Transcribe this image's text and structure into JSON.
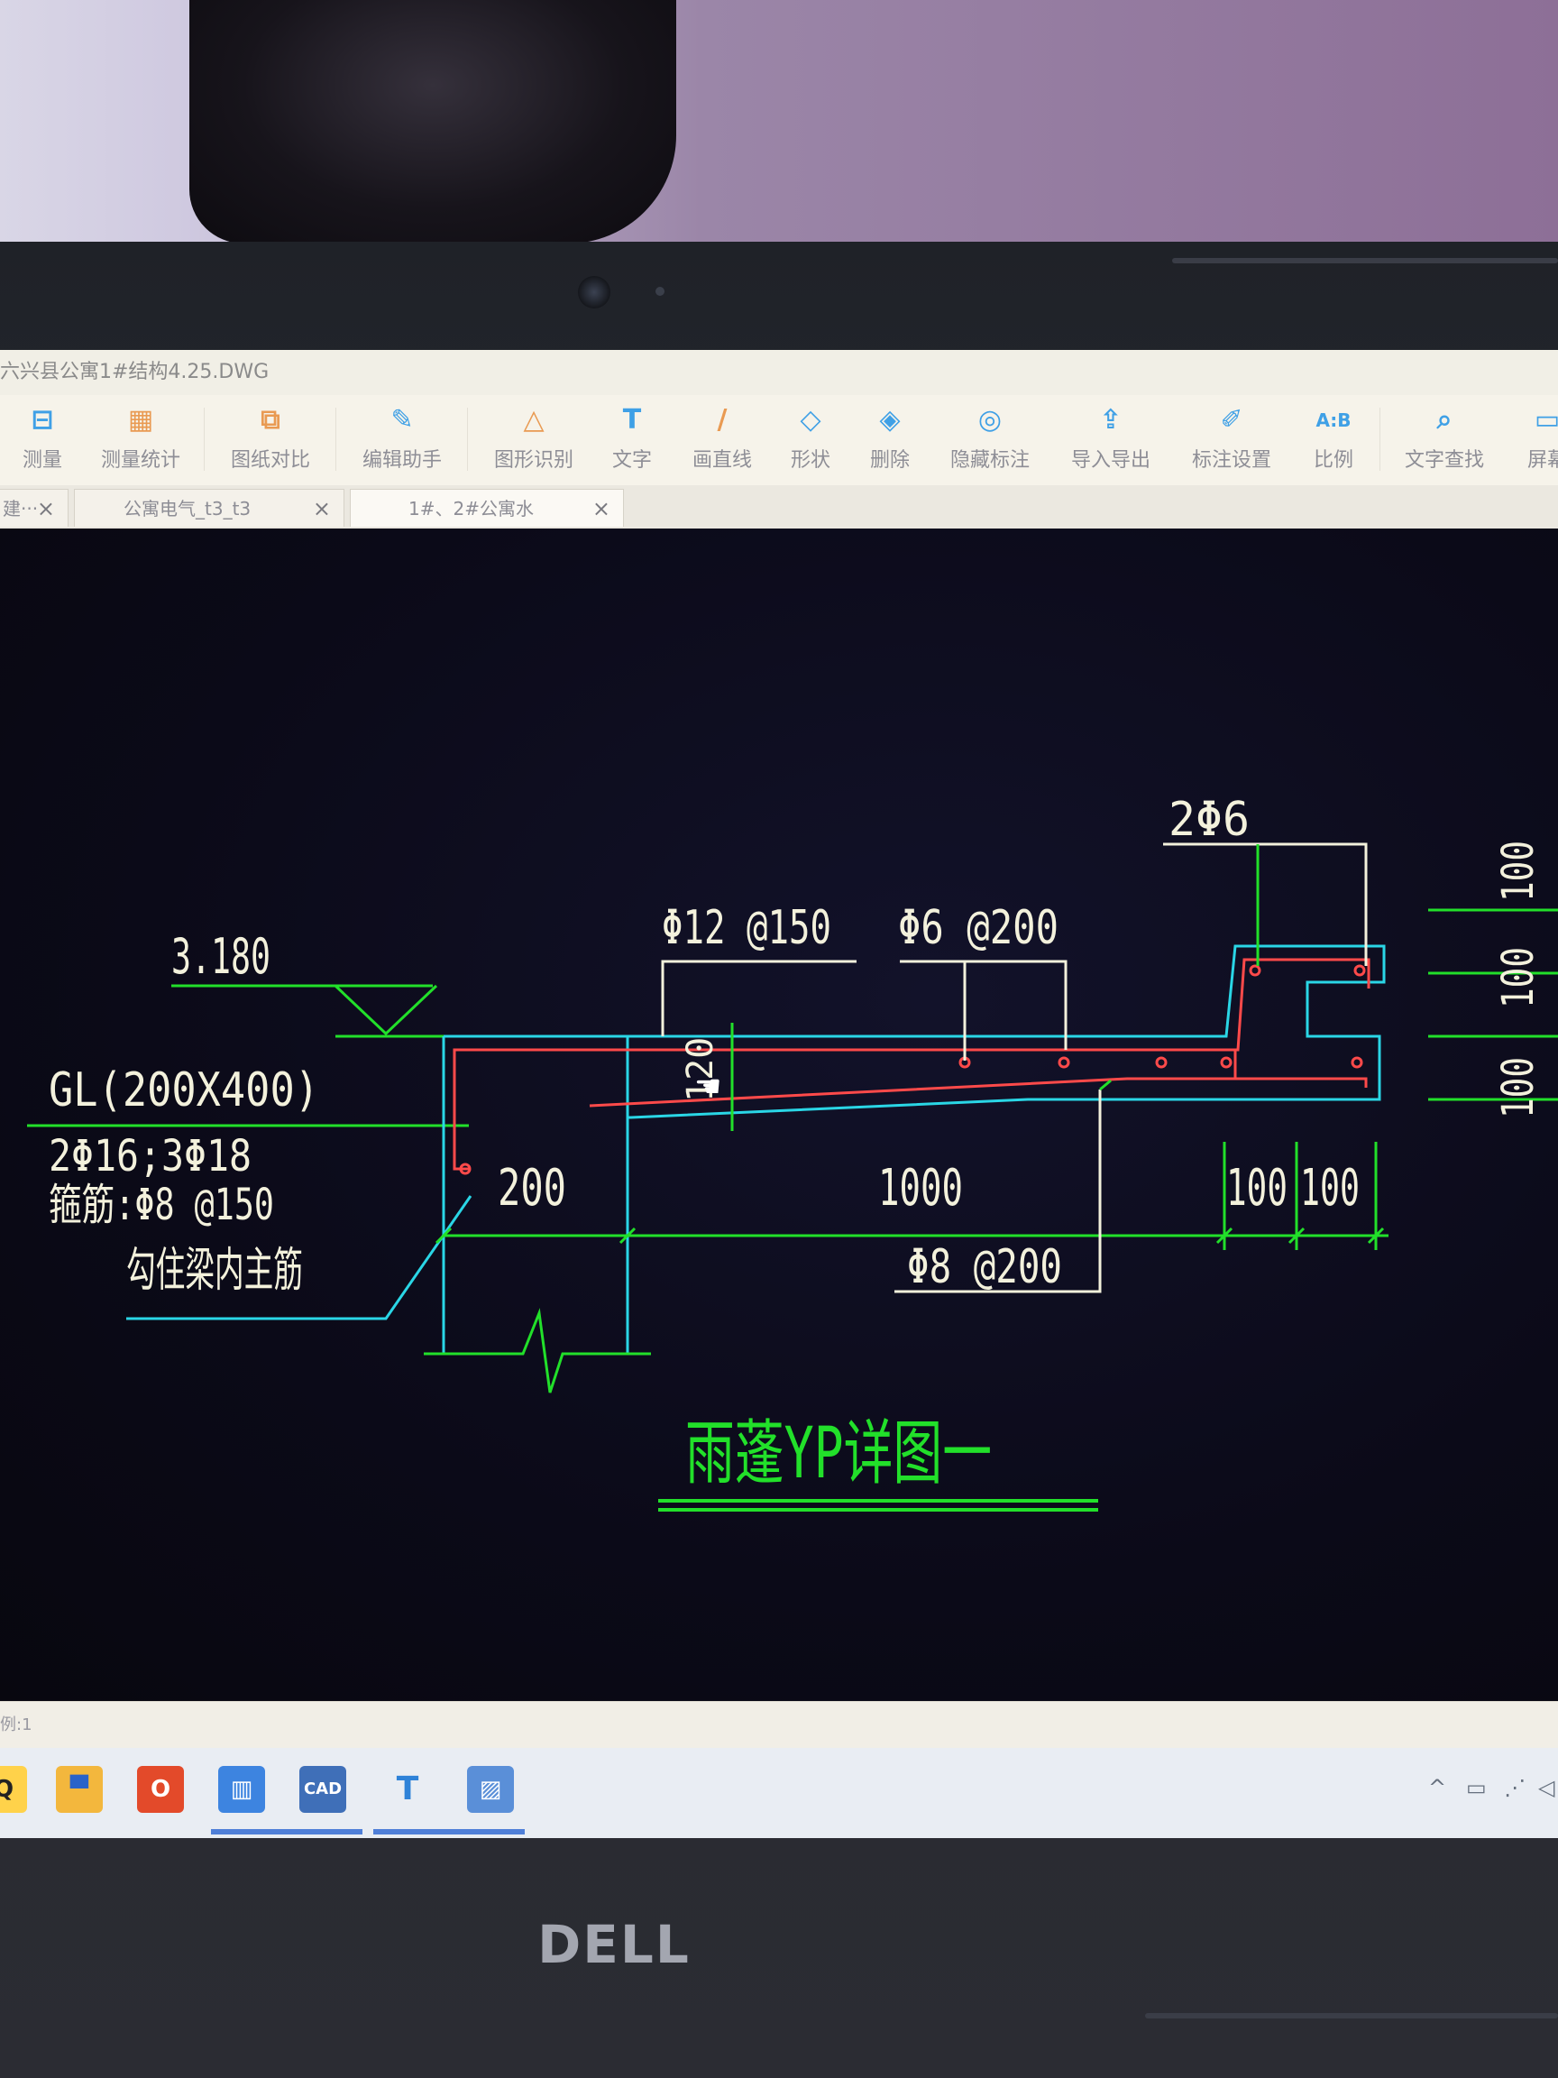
{
  "window": {
    "title": "六兴县公寓1#结构4.25.DWG"
  },
  "toolbar": {
    "items": [
      {
        "label": "测量",
        "icon": "measure-icon"
      },
      {
        "label": "测量统计",
        "icon": "measure-stats-icon"
      },
      {
        "label": "图纸对比",
        "icon": "compare-icon"
      },
      {
        "label": "编辑助手",
        "icon": "edit-assistant-icon"
      },
      {
        "label": "图形识别",
        "icon": "shape-recognition-icon"
      },
      {
        "label": "文字",
        "icon": "text-icon"
      },
      {
        "label": "画直线",
        "icon": "line-icon"
      },
      {
        "label": "形状",
        "icon": "shape-icon"
      },
      {
        "label": "删除",
        "icon": "eraser-icon"
      },
      {
        "label": "隐藏标注",
        "icon": "eye-hide-icon"
      },
      {
        "label": "导入导出",
        "icon": "import-export-icon"
      },
      {
        "label": "标注设置",
        "icon": "annotation-settings-icon"
      },
      {
        "label": "比例",
        "icon": "scale-icon"
      },
      {
        "label": "文字查找",
        "icon": "text-search-icon"
      },
      {
        "label": "屏幕",
        "icon": "screen-icon"
      }
    ]
  },
  "tabs": [
    {
      "label": "建···",
      "close": "×"
    },
    {
      "label": "公寓电气_t3_t3",
      "close": "×"
    },
    {
      "label": "1#、2#公寓水",
      "close": "×"
    }
  ],
  "drawing": {
    "elevation": "3.180",
    "beam_label": "GL(200X400)",
    "beam_bars": "2Φ16;3Φ18",
    "stirrup": "箍筋:Φ8 @150",
    "hook_note": "勾住梁内主筋",
    "top_bar_1": "Φ12 @150",
    "top_bar_2": "Φ6 @200",
    "edge_bars": "2Φ6",
    "slab_thickness": "120",
    "dim_200": "200",
    "dim_1000": "1000",
    "dim_100a": "100",
    "dim_100b": "100",
    "bottom_bar": "Φ8 @200",
    "right_dim_1": "100",
    "right_dim_2": "100",
    "right_dim_3": "100",
    "title": "雨蓬YP详图一",
    "colors": {
      "green": "#22e02a",
      "cyan": "#2ad6e6",
      "red": "#ff4a4a",
      "white": "#f3f1dc"
    }
  },
  "statusbar": {
    "text": "例:1"
  },
  "taskbar": {
    "apps": [
      {
        "name": "qq-icon",
        "label": "Q"
      },
      {
        "name": "file-explorer-icon",
        "label": "▀"
      },
      {
        "name": "office-icon",
        "label": "O"
      },
      {
        "name": "library-icon",
        "label": "▥"
      },
      {
        "name": "cad-icon",
        "label": "CAD"
      },
      {
        "name": "typora-icon",
        "label": "T"
      },
      {
        "name": "photo-viewer-icon",
        "label": "▨"
      }
    ],
    "tray": [
      "^",
      "▭",
      "⋰",
      "◁"
    ]
  },
  "laptop": {
    "brand": "DELL"
  }
}
